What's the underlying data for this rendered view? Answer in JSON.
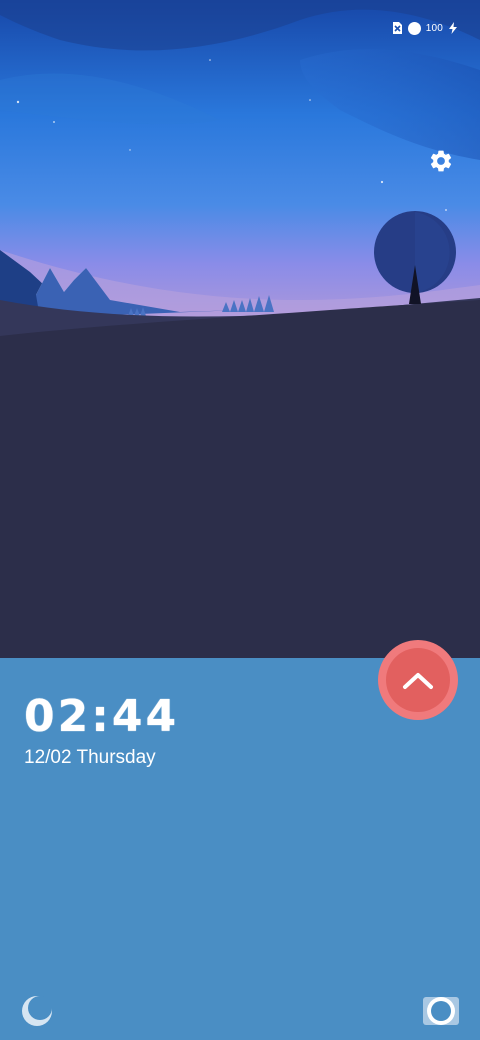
{
  "status_bar": {
    "sim_icon": "no-sim-icon",
    "dnd_icon": "circle-icon",
    "battery_level": "100",
    "charging_icon": "bolt-icon"
  },
  "wallpaper": {
    "description_icon": "landscape-night-illustration"
  },
  "settings": {
    "icon": "gear-icon"
  },
  "lockscreen": {
    "time": "02:44",
    "date": "12/02 Thursday"
  },
  "unlock": {
    "icon": "chevron-up-icon",
    "accent_color": "#e2605f"
  },
  "shortcuts": {
    "left_icon": "loading-circle-icon",
    "right_icon": "camera-lens-icon"
  },
  "colors": {
    "panel": "#4a8ec4",
    "ground": "#2c2e4a",
    "sky_top": "#1a4fb0",
    "sky_bottom": "#7c86e6"
  }
}
